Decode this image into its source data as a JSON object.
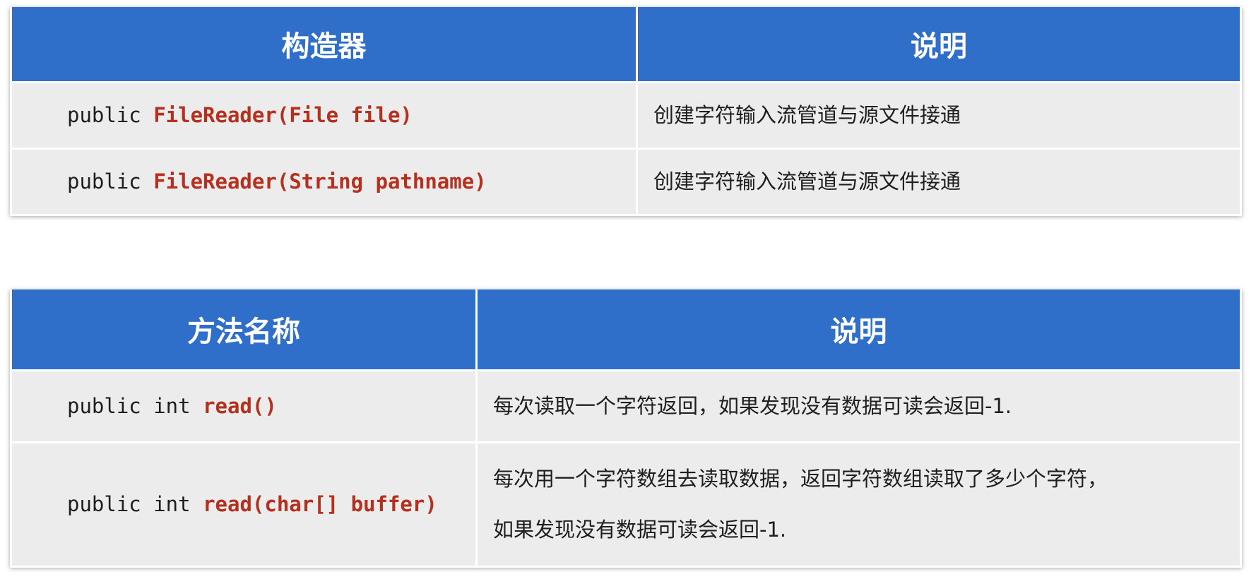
{
  "constructor_table": {
    "header": {
      "col1": "构造器",
      "col2": "说明"
    },
    "rows": [
      {
        "prefix": "public ",
        "name": "FileReader(File file)",
        "desc": "创建字符输入流管道与源文件接通"
      },
      {
        "prefix": "public ",
        "name": "FileReader(String pathname)",
        "desc": "创建字符输入流管道与源文件接通"
      }
    ]
  },
  "method_table": {
    "header": {
      "col1": "方法名称",
      "col2": "说明"
    },
    "rows": [
      {
        "prefix": "public int ",
        "name": "read()",
        "desc_line1": "每次读取一个字符返回，如果发现没有数据可读会返回-1.",
        "desc_line2": ""
      },
      {
        "prefix": "public int ",
        "name": "read(char[] buffer)",
        "desc_line1": "每次用一个字符数组去读取数据，返回字符数组读取了多少个字符，",
        "desc_line2": "如果发现没有数据可读会返回-1."
      }
    ]
  },
  "colors": {
    "header_bg": "#2f6fc9",
    "header_text": "#ffffff",
    "method_name": "#b5301e",
    "cell_bg": "#ececec"
  }
}
